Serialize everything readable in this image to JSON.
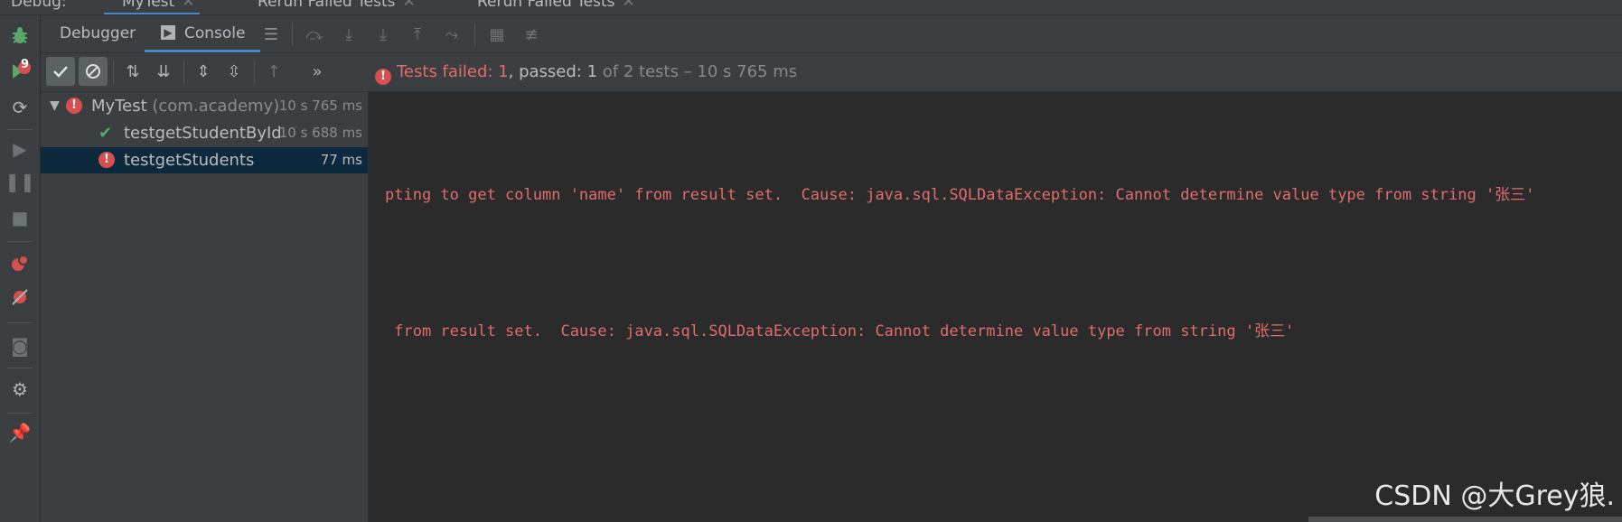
{
  "top_tabs": {
    "label": "Debug:",
    "tabs": [
      {
        "label": "MyTest",
        "active": true
      },
      {
        "label": "Rerun Failed Tests",
        "active": false
      },
      {
        "label": "Rerun Failed Tests",
        "active": false
      }
    ]
  },
  "panel_tabs": [
    {
      "label": "Debugger",
      "active": false
    },
    {
      "label": "Console",
      "active": true
    }
  ],
  "badge_count": "9",
  "status": {
    "failed_label": "Tests failed: ",
    "failed_count": "1",
    "passed_label": ", passed: ",
    "passed_count": "1",
    "of_total": " of 2 tests – 10 s 765 ms"
  },
  "tree": {
    "root": {
      "name": "MyTest",
      "package": "(com.academy)",
      "duration": "10 s 765 ms"
    },
    "children": [
      {
        "name": "testgetStudentById",
        "duration": "10 s 688 ms",
        "status": "passed"
      },
      {
        "name": "testgetStudents",
        "duration": "77 ms",
        "status": "failed",
        "selected": true
      }
    ]
  },
  "console_lines": [
    "pting to get column 'name' from result set.  Cause: java.sql.SQLDataException: Cannot determine value type from string '张三'",
    " from result set.  Cause: java.sql.SQLDataException: Cannot determine value type from string '张三'"
  ],
  "watermark": "CSDN @大Grey狼.",
  "colors": {
    "accent": "#4a88c7",
    "error": "#e06c6c",
    "success": "#59a869",
    "panel": "#3c3f41",
    "editor": "#2b2b2b"
  }
}
